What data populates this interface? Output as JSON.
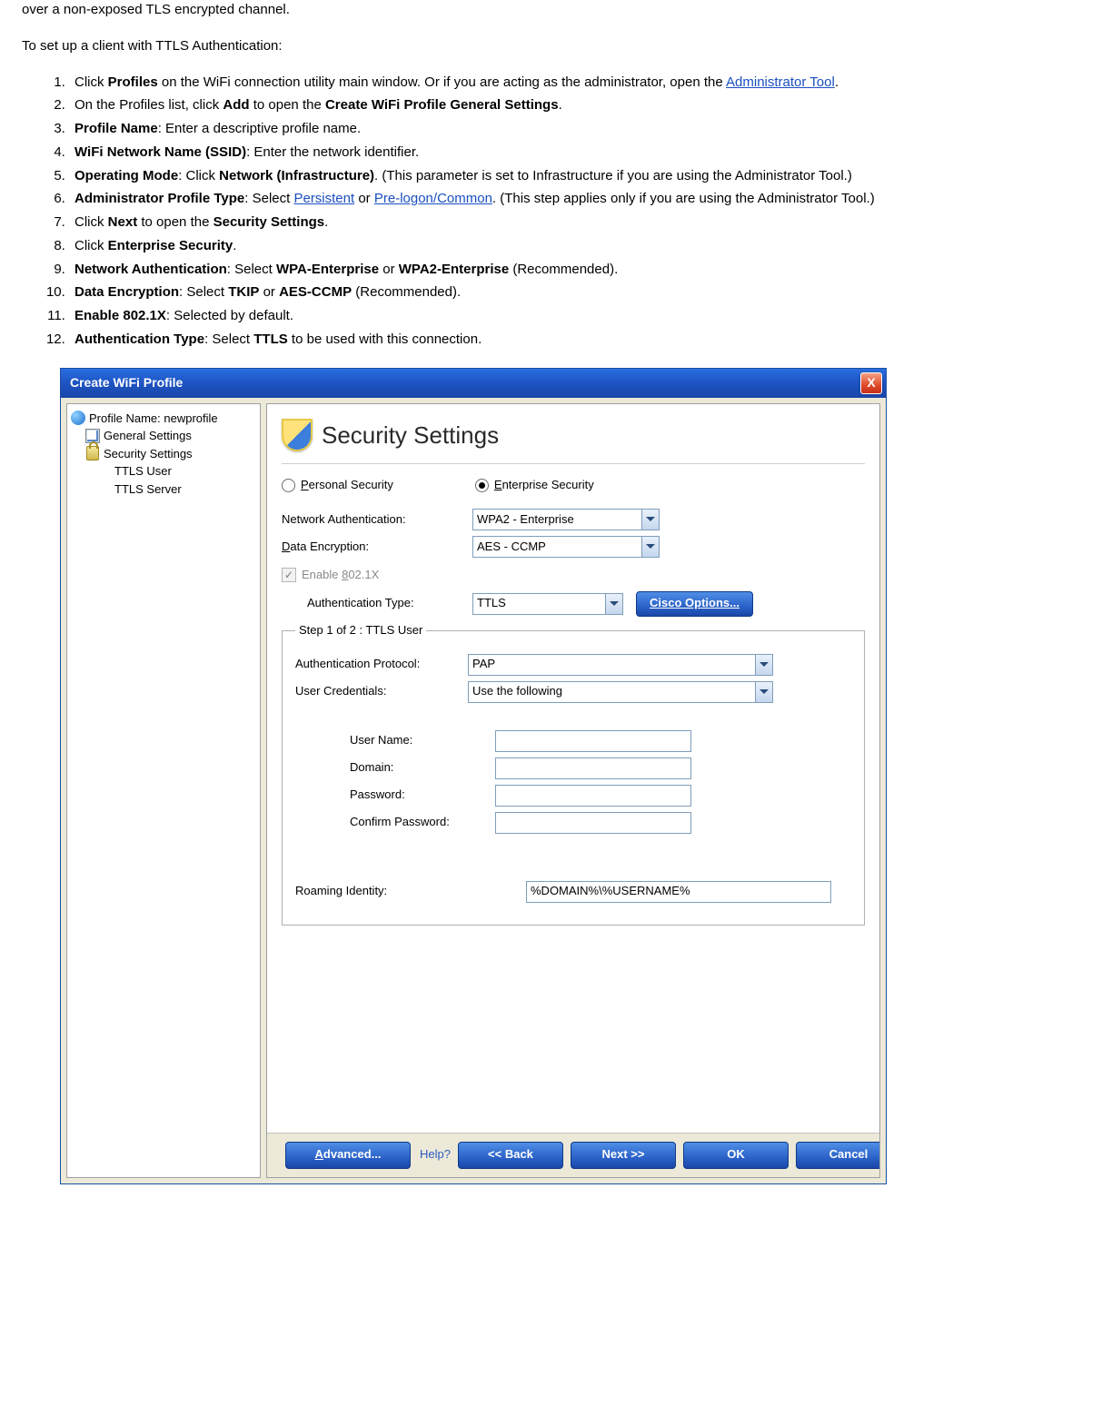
{
  "intro": {
    "line1": "over a non-exposed TLS encrypted channel.",
    "line2": "To set up a client with TTLS Authentication:"
  },
  "steps": {
    "s1a": "Click ",
    "s1b": "Profiles",
    "s1c": " on the WiFi connection utility main window. Or if you are acting as the administrator, open the ",
    "s1d": "Administrator Tool",
    "s1e": ".",
    "s2a": "On the Profiles list, click ",
    "s2b": "Add",
    "s2c": " to open the ",
    "s2d": "Create WiFi Profile General Settings",
    "s2e": ".",
    "s3a": "Profile Name",
    "s3b": ": Enter a descriptive profile name.",
    "s4a": "WiFi Network Name (SSID)",
    "s4b": ": Enter the network identifier.",
    "s5a": "Operating Mode",
    "s5b": ": Click ",
    "s5c": "Network (Infrastructure)",
    "s5d": ". (This parameter is set to Infrastructure if you are using the Administrator Tool.)",
    "s6a": "Administrator Profile Type",
    "s6b": ": Select ",
    "s6c": "Persistent",
    "s6d": " or ",
    "s6e": "Pre-logon/Common",
    "s6f": ". (This step applies only if you are using the Administrator Tool.)",
    "s7a": "Click ",
    "s7b": "Next",
    "s7c": " to open the ",
    "s7d": "Security Settings",
    "s7e": ".",
    "s8a": "Click ",
    "s8b": "Enterprise Security",
    "s8c": ".",
    "s9a": "Network Authentication",
    "s9b": ": Select ",
    "s9c": "WPA-Enterprise",
    "s9d": " or ",
    "s9e": "WPA2-Enterprise",
    "s9f": " (Recommended).",
    "s10a": "Data Encryption",
    "s10b": ": Select ",
    "s10c": "TKIP",
    "s10d": " or ",
    "s10e": "AES-CCMP",
    "s10f": " (Recommended).",
    "s11a": "Enable 802.1X",
    "s11b": ": Selected by default.",
    "s12a": "Authentication Type",
    "s12b": ": Select ",
    "s12c": "TTLS",
    "s12d": " to be used with this connection."
  },
  "dialog": {
    "title": "Create WiFi Profile",
    "close": "X",
    "tree": {
      "profile": "Profile Name: newprofile",
      "general": "General Settings",
      "security": "Security Settings",
      "ttls_user": "TTLS User",
      "ttls_server": "TTLS Server"
    },
    "panel": {
      "heading": "Security Settings",
      "personal_p": "P",
      "personal_rest": "ersonal Security",
      "enterprise_e": "E",
      "enterprise_rest": "nterprise Security",
      "net_auth_label": "Network Authentication:",
      "net_auth_value": "WPA2 - Enterprise",
      "data_enc_d": "D",
      "data_enc_rest": "ata Encryption:",
      "data_enc_value": "AES - CCMP",
      "enable_pre": "Enable ",
      "enable_u": "8",
      "enable_post": "02.1X",
      "auth_type_label": "Authentication Type:",
      "auth_type_value": "TTLS",
      "cisco_c": "C",
      "cisco_rest": "isco Options...",
      "step_legend": "Step 1 of 2 : TTLS User",
      "auth_proto_label": "Authentication Protocol:",
      "auth_proto_value": "PAP",
      "user_cred_label": "User Credentials:",
      "user_cred_value": "Use the following",
      "user_name": "User Name:",
      "domain": "Domain:",
      "password": "Password:",
      "confirm_pw": "Confirm Password:",
      "roaming_label": "Roaming Identity:",
      "roaming_value": "%DOMAIN%\\%USERNAME%"
    },
    "footer": {
      "advanced_a": "A",
      "advanced_rest": "dvanced...",
      "help": "Help?",
      "back": "<< Back",
      "next": "Next >>",
      "ok": "OK",
      "cancel": "Cancel"
    }
  }
}
